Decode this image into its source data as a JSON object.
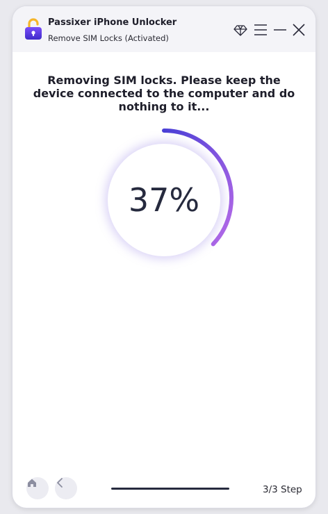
{
  "app": {
    "title": "Passixer iPhone Unlocker",
    "subtitle": "Remove SIM Locks (Activated)"
  },
  "icons": {
    "logo": "unlock-padlock-icon",
    "premium": "diamond-icon",
    "menu": "menu-icon",
    "minimize": "minimize-icon",
    "close": "close-icon",
    "home": "home-icon",
    "back": "chevron-left-icon"
  },
  "colors": {
    "accent_start": "#4a3fd6",
    "accent_end": "#b86be8",
    "text": "#262a3e"
  },
  "main": {
    "message": "Removing SIM locks. Please keep the device connected to the computer and do nothing to it..."
  },
  "progress": {
    "value": 0.37,
    "label": "37%"
  },
  "footer": {
    "step": "3/3 Step"
  }
}
